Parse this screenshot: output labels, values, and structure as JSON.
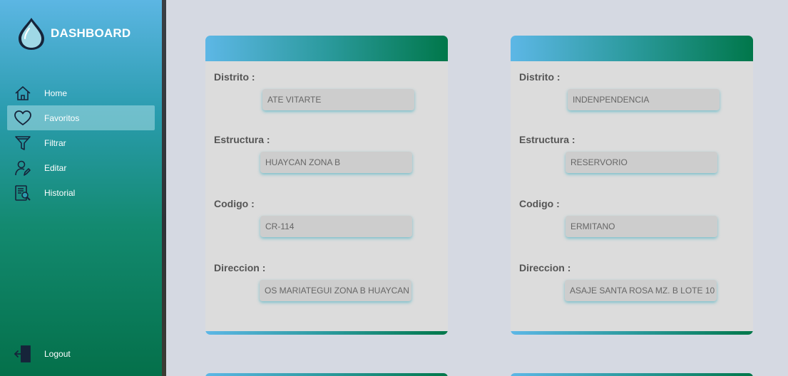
{
  "sidebar": {
    "brand": "DASHBOARD",
    "items": [
      {
        "label": "Home",
        "icon": "home-icon"
      },
      {
        "label": "Favoritos",
        "icon": "heart-icon"
      },
      {
        "label": "Filtrar",
        "icon": "filter-icon"
      },
      {
        "label": "Editar",
        "icon": "user-edit-icon"
      },
      {
        "label": "Historial",
        "icon": "history-icon"
      }
    ],
    "active_item": "Favoritos",
    "logout": {
      "label": "Logout",
      "icon": "logout-icon"
    }
  },
  "labels": {
    "distrito": "Distrito :",
    "estructura": "Estructura :",
    "codigo": "Codigo :",
    "direccion": "Direccion :"
  },
  "cards": [
    {
      "distrito": "ATE VITARTE",
      "estructura": "HUAYCAN ZONA B",
      "codigo": "CR-114",
      "direccion": "OS MARIATEGUI ZONA B HUAYCAN"
    },
    {
      "distrito": "INDENPENDENCIA",
      "estructura": "RESERVORIO",
      "codigo": "ERMITANO",
      "direccion": "ASAJE SANTA ROSA MZ. B LOTE 10"
    }
  ],
  "colors": {
    "sidebar_top": "#5cb6e3",
    "sidebar_bottom": "#04704a",
    "card_header_start": "#5db7e6",
    "card_header_end": "#00774a",
    "background": "#d5d9e2"
  }
}
